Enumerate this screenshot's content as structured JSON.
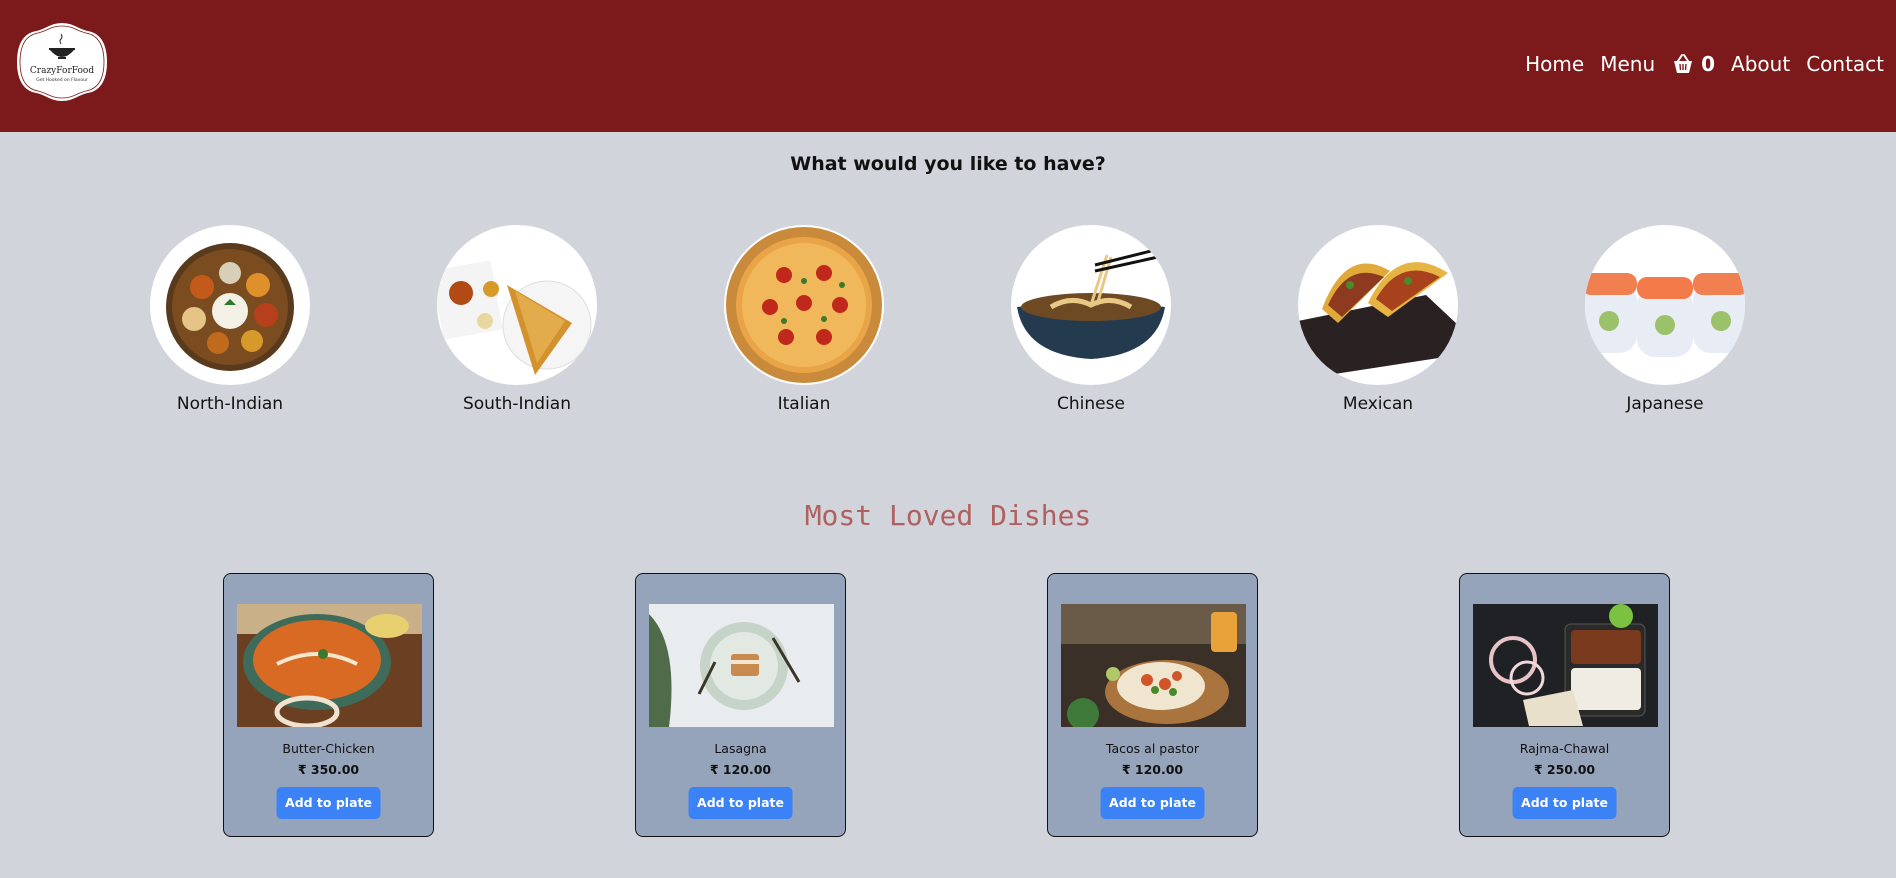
{
  "brand": {
    "name": "CrazyForFood",
    "tagline": "Get Hooked on Flavour"
  },
  "nav": {
    "home": "Home",
    "menu": "Menu",
    "cart_count": "0",
    "about": "About",
    "contact": "Contact"
  },
  "colors": {
    "header": "#7c1a1b",
    "background": "#d1d4db",
    "card": "#95a4bb",
    "button": "#3b82f6",
    "section_title": "#b0605e"
  },
  "prompt": "What would you like to have?",
  "cuisines": [
    {
      "label": "North-Indian",
      "icon": "thali-image"
    },
    {
      "label": "South-Indian",
      "icon": "dosa-image"
    },
    {
      "label": "Italian",
      "icon": "pizza-image"
    },
    {
      "label": "Chinese",
      "icon": "noodles-image"
    },
    {
      "label": "Mexican",
      "icon": "tacos-image"
    },
    {
      "label": "Japanese",
      "icon": "sushi-image"
    }
  ],
  "loved": {
    "title": "Most Loved Dishes",
    "dishes": [
      {
        "name": "Butter-Chicken",
        "price": "₹ 350.00",
        "button": "Add to plate"
      },
      {
        "name": "Lasagna",
        "price": "₹ 120.00",
        "button": "Add to plate"
      },
      {
        "name": "Tacos al pastor",
        "price": "₹ 120.00",
        "button": "Add to plate"
      },
      {
        "name": "Rajma-Chawal",
        "price": "₹ 250.00",
        "button": "Add to plate"
      }
    ]
  }
}
